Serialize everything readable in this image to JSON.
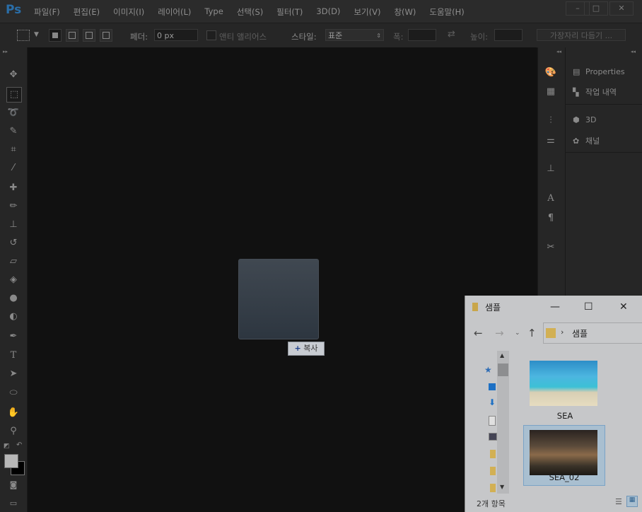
{
  "app": {
    "logo": "Ps"
  },
  "menu": [
    "파일(F)",
    "편집(E)",
    "이미지(I)",
    "레이어(L)",
    "Type",
    "선택(S)",
    "필터(T)",
    "3D(D)",
    "보기(V)",
    "창(W)",
    "도움말(H)"
  ],
  "window_controls": {
    "minimize": "–",
    "maximize": "□",
    "close": "✕"
  },
  "options": {
    "feather_label": "페더:",
    "feather_value": "0 px",
    "antialias_label": "앤티 앨리어스",
    "style_label": "스타일:",
    "style_value": "표준",
    "width_label": "폭:",
    "height_label": "높이:",
    "refine_edge": "가장자리 다듬기 ..."
  },
  "right_panel": {
    "items": [
      "Properties",
      "작업 내역",
      "3D",
      "채널"
    ]
  },
  "drag": {
    "tooltip": "복사",
    "tooltip_icon": "+"
  },
  "explorer": {
    "title": "샘플",
    "address": "샘플",
    "items": [
      {
        "name": "SEA",
        "selected": false
      },
      {
        "name": "SEA_02",
        "selected": true
      }
    ],
    "status": "2개 항목"
  },
  "colors": {
    "accent": "#2a6ea8",
    "selection": "#cfe2f3"
  }
}
